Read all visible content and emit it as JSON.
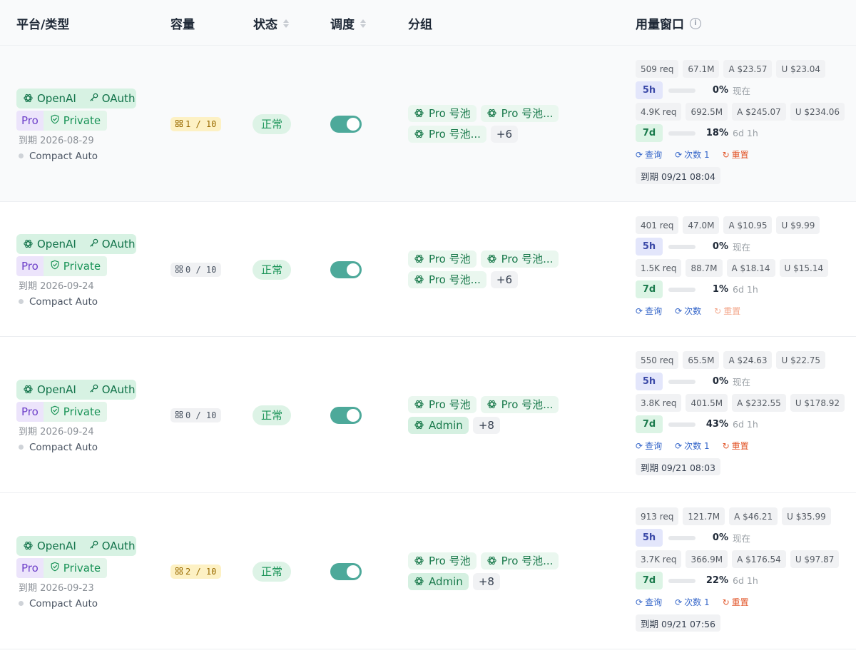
{
  "columns": {
    "platform": "平台/类型",
    "capacity": "容量",
    "status": "状态",
    "schedule": "调度",
    "groups": "分组",
    "usage": "用量窗口"
  },
  "rows": [
    {
      "platform": "OpenAI",
      "auth": "OAuth",
      "plan": "Pro",
      "visibility": "Private",
      "expire": "到期 2026-08-29",
      "mode": "Compact Auto",
      "capacity": "1 / 10",
      "capacity_hot": true,
      "status": "正常",
      "schedule_on": true,
      "group_row1": [
        "Pro 号池",
        "Pro 号池..."
      ],
      "group_row2": [
        "Pro 号池..."
      ],
      "group_more": "+6",
      "stats5": [
        "509 req",
        "67.1M",
        "A $23.57",
        "U $23.04"
      ],
      "w5": {
        "label": "5h",
        "percent": "0%",
        "reset": "现在",
        "fill": 0
      },
      "stats7": [
        "4.9K req",
        "692.5M",
        "A $245.07",
        "U $234.06"
      ],
      "w7": {
        "label": "7d",
        "percent": "18%",
        "reset": "6d 1h",
        "fill": 18
      },
      "actions": [
        "查询",
        "次数 1",
        "重置"
      ],
      "reset_active": true,
      "expire_window": "到期 09/21 08:04"
    },
    {
      "platform": "OpenAI",
      "auth": "OAuth",
      "plan": "Pro",
      "visibility": "Private",
      "expire": "到期 2026-09-24",
      "mode": "Compact Auto",
      "capacity": "0 / 10",
      "capacity_hot": false,
      "status": "正常",
      "schedule_on": true,
      "group_row1": [
        "Pro 号池",
        "Pro 号池..."
      ],
      "group_row2": [
        "Pro 号池..."
      ],
      "group_more": "+6",
      "stats5": [
        "401 req",
        "47.0M",
        "A $10.95",
        "U $9.99"
      ],
      "w5": {
        "label": "5h",
        "percent": "0%",
        "reset": "现在",
        "fill": 0
      },
      "stats7": [
        "1.5K req",
        "88.7M",
        "A $18.14",
        "U $15.14"
      ],
      "w7": {
        "label": "7d",
        "percent": "1%",
        "reset": "6d 1h",
        "fill": 1
      },
      "actions": [
        "查询",
        "次数",
        "重置"
      ],
      "reset_active": false,
      "expire_window": ""
    },
    {
      "platform": "OpenAI",
      "auth": "OAuth",
      "plan": "Pro",
      "visibility": "Private",
      "expire": "到期 2026-09-24",
      "mode": "Compact Auto",
      "capacity": "0 / 10",
      "capacity_hot": false,
      "status": "正常",
      "schedule_on": true,
      "group_row1": [
        "Pro 号池",
        "Pro 号池..."
      ],
      "group_row2": [
        "Admin"
      ],
      "group_more": "+8",
      "stats5": [
        "550 req",
        "65.5M",
        "A $24.63",
        "U $22.75"
      ],
      "w5": {
        "label": "5h",
        "percent": "0%",
        "reset": "现在",
        "fill": 0
      },
      "stats7": [
        "3.8K req",
        "401.5M",
        "A $232.55",
        "U $178.92"
      ],
      "w7": {
        "label": "7d",
        "percent": "43%",
        "reset": "6d 1h",
        "fill": 43
      },
      "actions": [
        "查询",
        "次数 1",
        "重置"
      ],
      "reset_active": true,
      "expire_window": "到期 09/21 08:03"
    },
    {
      "platform": "OpenAI",
      "auth": "OAuth",
      "plan": "Pro",
      "visibility": "Private",
      "expire": "到期 2026-09-23",
      "mode": "Compact Auto",
      "capacity": "2 / 10",
      "capacity_hot": true,
      "status": "正常",
      "schedule_on": true,
      "group_row1": [
        "Pro 号池",
        "Pro 号池..."
      ],
      "group_row2": [
        "Admin"
      ],
      "group_more": "+8",
      "stats5": [
        "913 req",
        "121.7M",
        "A $46.21",
        "U $35.99"
      ],
      "w5": {
        "label": "5h",
        "percent": "0%",
        "reset": "现在",
        "fill": 0
      },
      "stats7": [
        "3.7K req",
        "366.9M",
        "A $176.54",
        "U $97.87"
      ],
      "w7": {
        "label": "7d",
        "percent": "22%",
        "reset": "6d 1h",
        "fill": 22
      },
      "actions": [
        "查询",
        "次数 1",
        "重置"
      ],
      "reset_active": true,
      "expire_window": "到期 09/21 07:56"
    }
  ],
  "colors": {
    "accent_green": "#4da99a",
    "status_green": "#199357",
    "plan_purple": "#6d3fc9",
    "reset_red": "#e2572b",
    "link_blue": "#3566c9"
  }
}
